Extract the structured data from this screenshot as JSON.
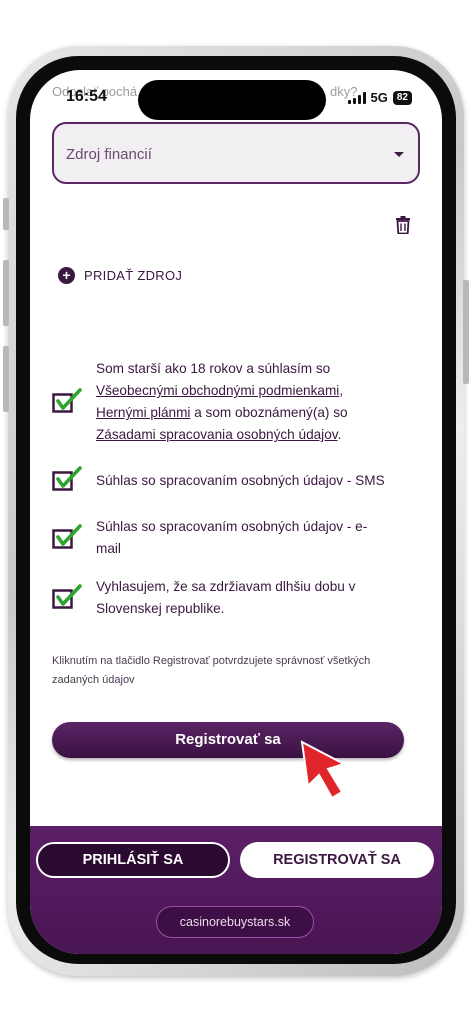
{
  "status": {
    "time": "16:54",
    "network": "5G",
    "battery": "82",
    "behind_text_left": "Odoslať pochá",
    "behind_text_right": "dky?"
  },
  "form": {
    "source_select_placeholder": "Zdroj financií",
    "add_source_label": "PRIDAŤ ZDROJ",
    "consents": [
      {
        "checked": true,
        "parts": [
          "Som starší ako 18 rokov a súhlasím so ",
          "Všeobecnými obchodnými podmienkami",
          ", ",
          "Hernými plánmi",
          " a som oboznámený(a) so ",
          "Zásadami spracovania osobných údajov",
          "."
        ]
      },
      {
        "checked": true,
        "text": "Súhlas so spracovaním osobných údajov - SMS"
      },
      {
        "checked": true,
        "text": "Súhlas so spracovaním osobných údajov - e-mail"
      },
      {
        "checked": true,
        "text": "Vyhlasujem, že sa zdržiavam dlhšiu dobu v Slovenskej republike."
      }
    ],
    "note": "Kliknutím na tlačidlo Registrovať potvrdzujete správnosť všetkých zadaných údajov",
    "register_button": "Registrovať sa"
  },
  "bottom_nav": {
    "login_button": "PRIHLÁSIŤ SA",
    "register_button": "REGISTROVAŤ SA",
    "url": "casinorebuystars.sk"
  },
  "colors": {
    "brand_purple": "#4a1553",
    "checkbox_border": "#3b1840",
    "checkmark_green": "#2ea52e",
    "cursor_red": "#e0262a"
  },
  "icons": [
    "trash-icon",
    "plus-circle-icon",
    "checkbox-checked-icon",
    "pointer-cursor-icon",
    "signal-icon",
    "battery-icon"
  ]
}
